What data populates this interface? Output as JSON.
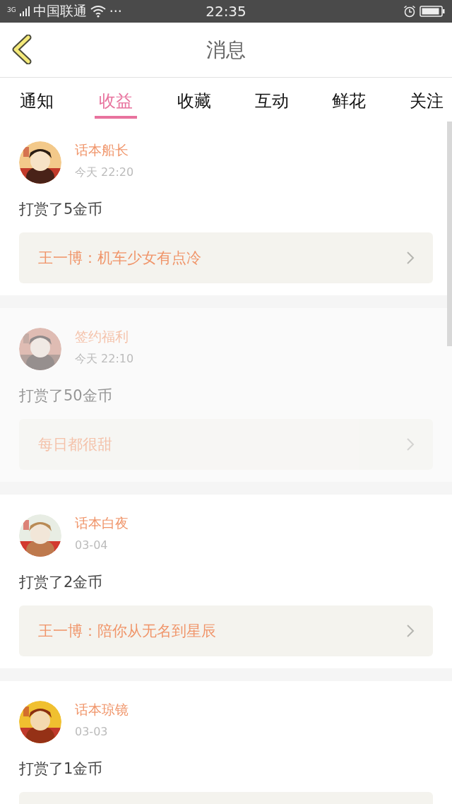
{
  "status_bar": {
    "network": "3G",
    "carrier": "中国联通",
    "more": "···",
    "time": "22:35"
  },
  "header": {
    "title": "消息"
  },
  "tabs": [
    {
      "label": "通知",
      "selected": false
    },
    {
      "label": "收益",
      "selected": true
    },
    {
      "label": "收藏",
      "selected": false
    },
    {
      "label": "互动",
      "selected": false
    },
    {
      "label": "鲜花",
      "selected": false
    },
    {
      "label": "关注",
      "selected": false
    }
  ],
  "messages": [
    {
      "name": "话本船长",
      "time": "今天 22:20",
      "text": "打赏了5金币",
      "link": {
        "kind": "story",
        "title": "王一博：机车少女有点冷"
      },
      "faded": false
    },
    {
      "name": "签约福利",
      "time": "今天 22:10",
      "text": "打赏了50金币",
      "link": {
        "kind": "story",
        "title": "每日都很甜"
      },
      "faded": true
    },
    {
      "name": "话本白夜",
      "time": "03-04",
      "text": "打赏了2金币",
      "link": {
        "kind": "story",
        "title": "王一博：陪你从无名到星辰"
      },
      "faded": false
    },
    {
      "name": "话本琼镜",
      "time": "03-03",
      "text": "打赏了1金币",
      "link": {
        "kind": "cut"
      },
      "faded": false
    }
  ]
}
